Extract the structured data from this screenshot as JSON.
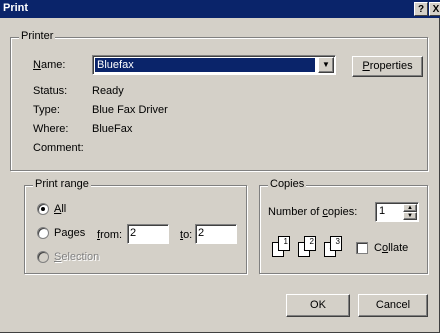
{
  "window": {
    "title": "Print",
    "help_label": "?",
    "close_label": "X"
  },
  "printer": {
    "legend": "Printer",
    "name_label": "Name:",
    "name_value": "Bluefax",
    "properties_label": "Properties",
    "status_label": "Status:",
    "status_value": "Ready",
    "type_label": "Type:",
    "type_value": "Blue Fax Driver",
    "where_label": "Where:",
    "where_value": "BlueFax",
    "comment_label": "Comment:",
    "comment_value": ""
  },
  "print_range": {
    "legend": "Print range",
    "all_label": "All",
    "pages_label": "Pages",
    "from_label": "from:",
    "from_value": "2",
    "to_label": "to:",
    "to_value": "2",
    "selection_label": "Selection",
    "selected": "all"
  },
  "copies": {
    "legend": "Copies",
    "number_label": "Number of copies:",
    "number_value": "1",
    "collate_label": "Collate",
    "collate_checked": false,
    "page_numbers": [
      "1",
      "1",
      "2",
      "2",
      "3",
      "3"
    ]
  },
  "buttons": {
    "ok_label": "OK",
    "cancel_label": "Cancel"
  },
  "colors": {
    "face": "#d4d0c8",
    "titlebar": "#0a246a",
    "selection": "#0a246a"
  }
}
